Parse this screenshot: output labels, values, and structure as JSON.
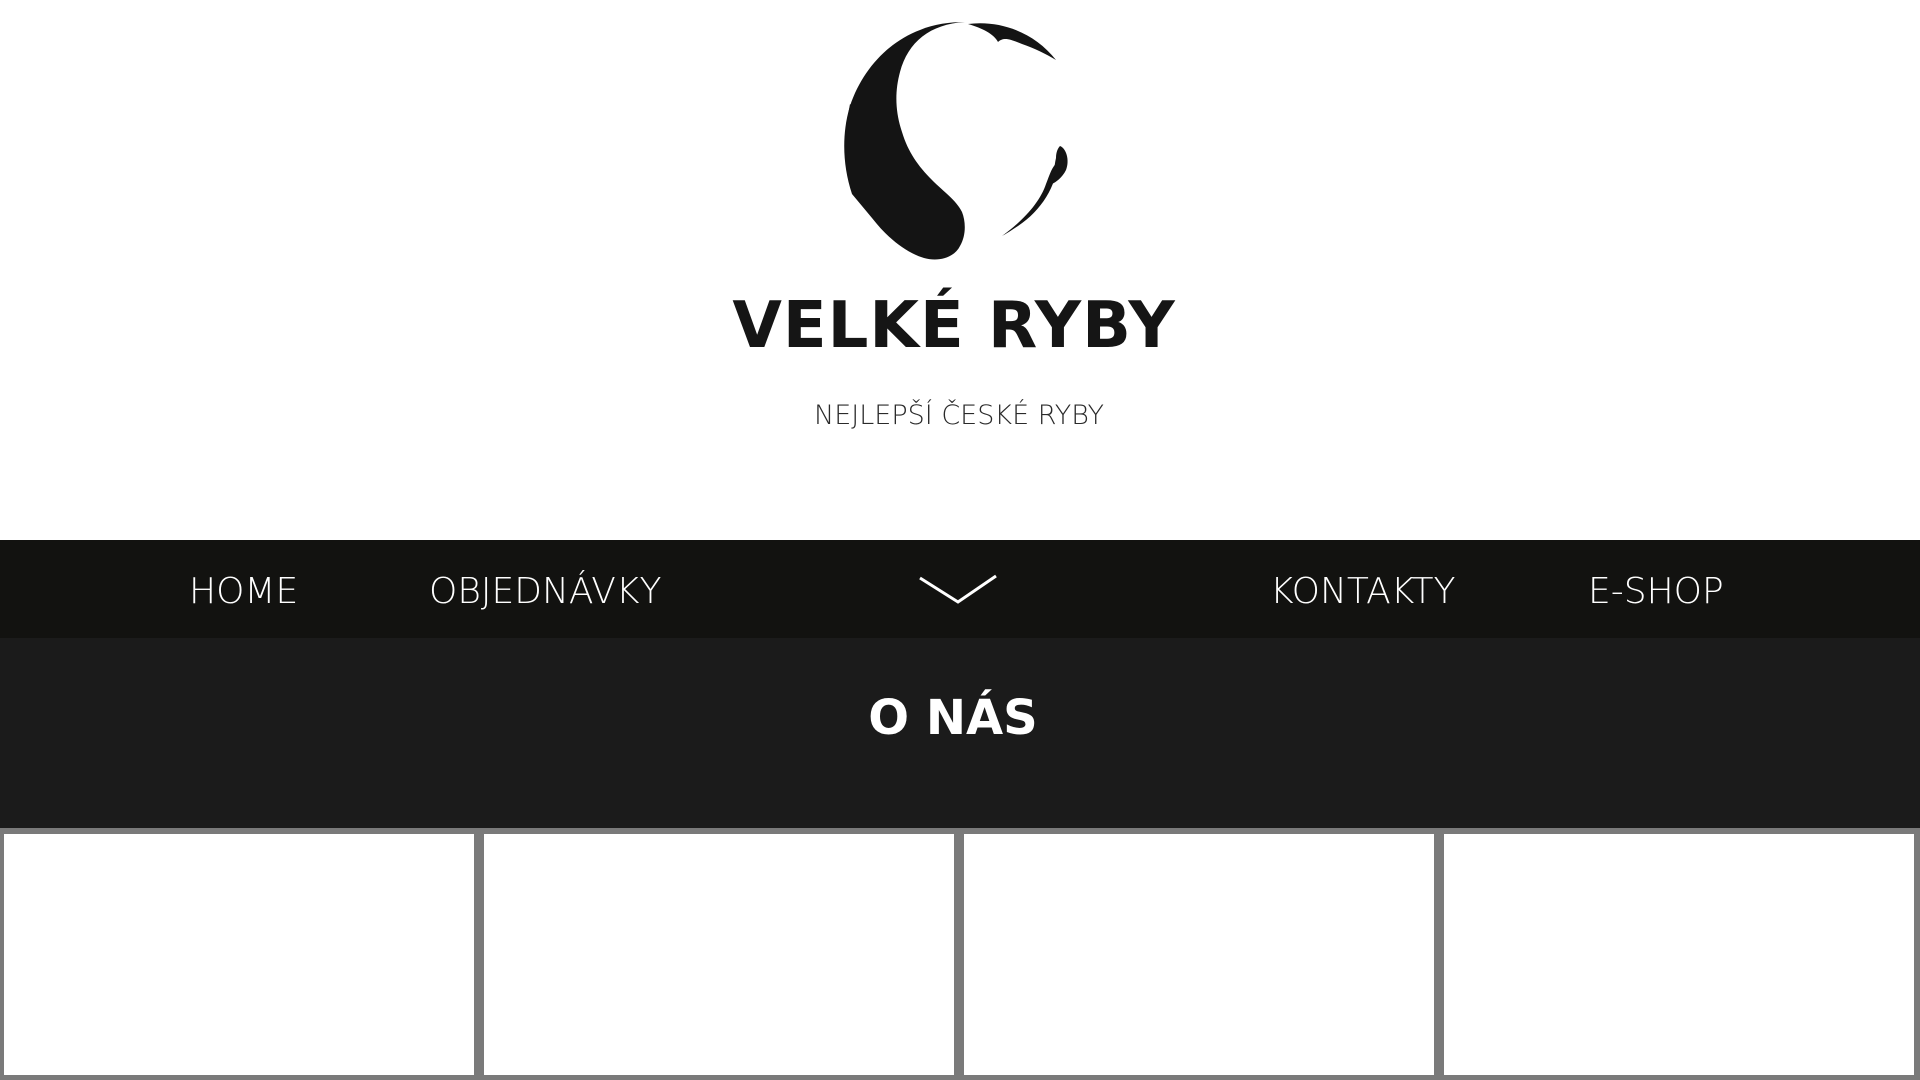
{
  "brand": {
    "title": "VELKÉ RYBY",
    "subtitle": "NEJLEPŠÍ ČESKÉ RYBY",
    "logo_icon": "fish-circle-logo"
  },
  "nav": {
    "items": [
      {
        "label": "HOME"
      },
      {
        "label": "OBJEDNÁVKY"
      },
      {
        "label": "KONTAKTY"
      },
      {
        "label": "E-SHOP"
      }
    ],
    "toggle_icon": "chevron-down-icon"
  },
  "section": {
    "title": "O NÁS"
  },
  "colors": {
    "nav_background": "#121210",
    "section_background": "#1b1b1b",
    "tile_border": "#7a7a7a",
    "text_dark": "#151515"
  }
}
